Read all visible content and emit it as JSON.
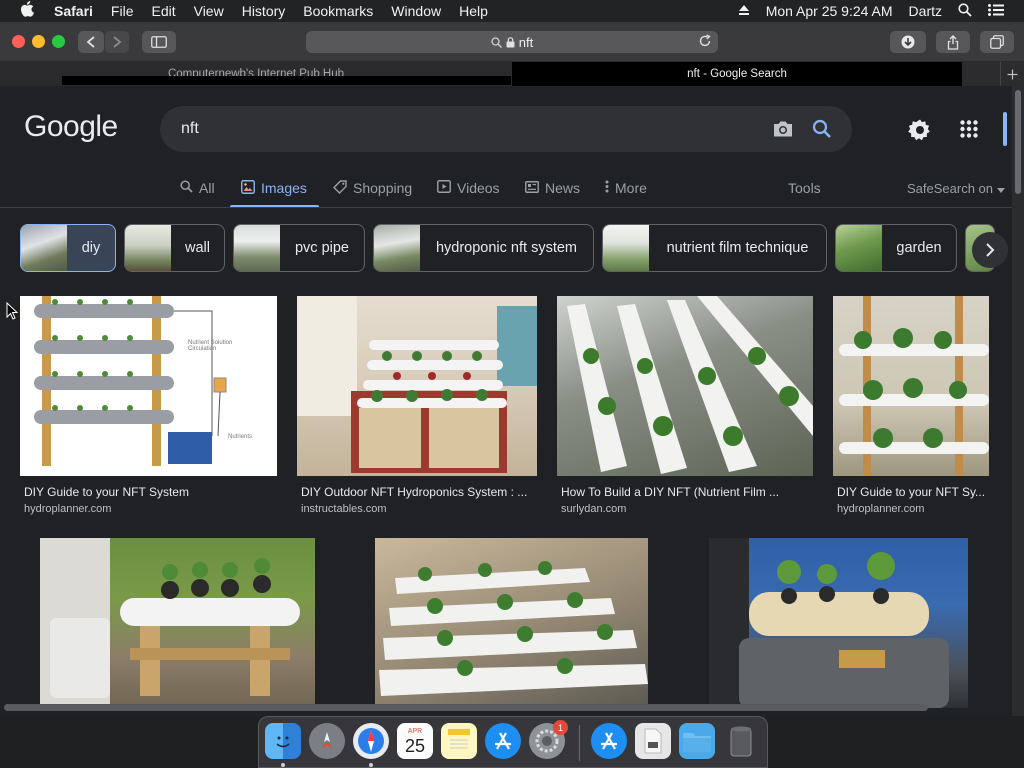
{
  "menubar": {
    "app": "Safari",
    "items": [
      "File",
      "Edit",
      "View",
      "History",
      "Bookmarks",
      "Window",
      "Help"
    ],
    "clock": "Mon Apr 25  9:24 AM",
    "user": "Dartz"
  },
  "browser": {
    "url": "nft",
    "tabs": [
      "Computernewb's Internet Pub Hub",
      "nft - Google Search"
    ]
  },
  "google": {
    "logo": "Google",
    "query": "nft",
    "nav": [
      "All",
      "Images",
      "Shopping",
      "Videos",
      "News",
      "More"
    ],
    "tools": "Tools",
    "safesearch": "SafeSearch on",
    "chips": [
      "diy",
      "wall",
      "pvc pipe",
      "hydroponic nft system",
      "nutrient film technique",
      "garden"
    ],
    "results": [
      {
        "title": "DIY Guide to your NFT System",
        "source": "hydroplanner.com"
      },
      {
        "title": "DIY Outdoor NFT Hydroponics System : ...",
        "source": "instructables.com"
      },
      {
        "title": "How To Build a DIY NFT (Nutrient Film ...",
        "source": "surlydan.com"
      },
      {
        "title": "DIY Guide to your NFT Sy...",
        "source": "hydroplanner.com"
      }
    ],
    "diagram_labels": [
      "Nutrient Solution Circulation",
      "Nutrients"
    ]
  },
  "calendar": {
    "month": "APR",
    "day": "25"
  },
  "badge": "1",
  "colors": {
    "accent": "#8ab4f8",
    "page_bg": "#202124",
    "surface": "#303134"
  }
}
